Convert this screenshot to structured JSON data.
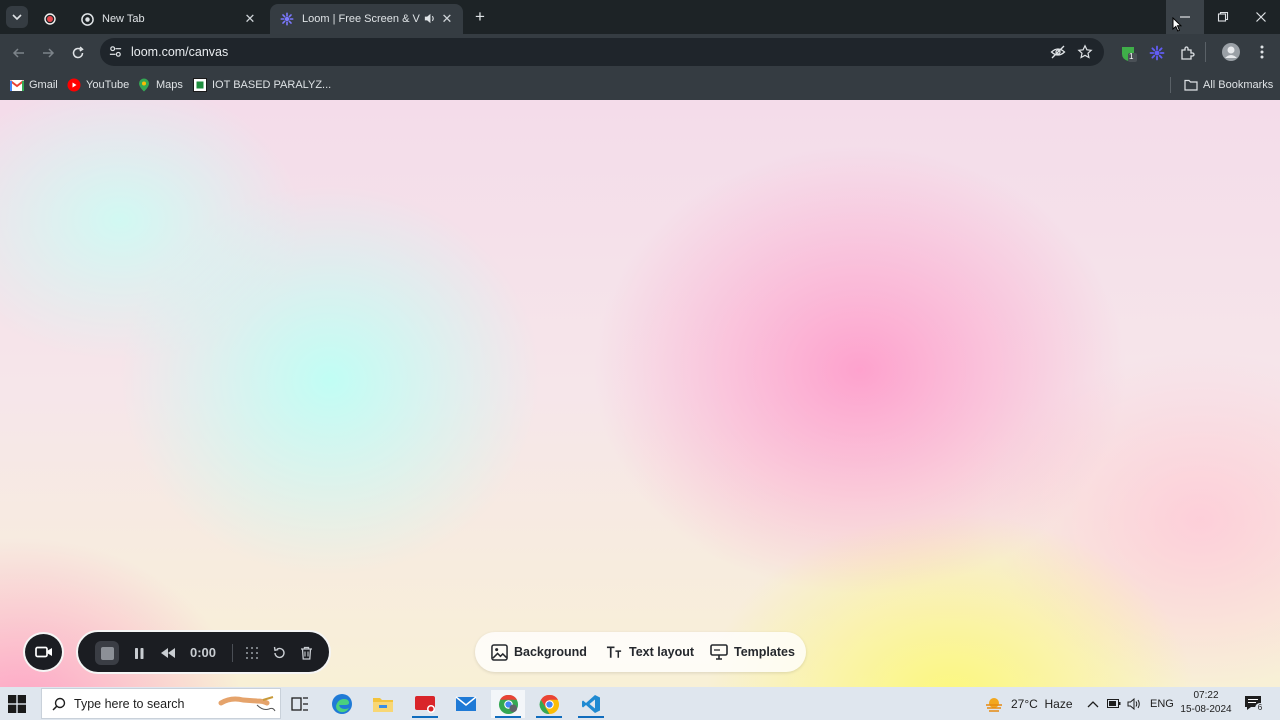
{
  "browser": {
    "tabs": [
      {
        "title": "",
        "favicon": "record-icon",
        "active": false
      },
      {
        "title": "New Tab",
        "favicon": "chrome-icon",
        "active": false
      },
      {
        "title": "Loom | Free Screen & Video",
        "favicon": "loom-icon",
        "active": true,
        "audio": true
      }
    ],
    "url": "loom.com/canvas",
    "extension_badge": "1"
  },
  "bookmarks": {
    "items": [
      {
        "label": "Gmail",
        "icon": "gmail-icon"
      },
      {
        "label": "YouTube",
        "icon": "youtube-icon"
      },
      {
        "label": "Maps",
        "icon": "maps-icon"
      },
      {
        "label": "IOT BASED PARALYZ...",
        "icon": "site-icon"
      }
    ],
    "all_bookmarks": "All Bookmarks"
  },
  "recorder": {
    "time": "0:00"
  },
  "canvas_toolbar": {
    "background": "Background",
    "text_layout": "Text layout",
    "templates": "Templates"
  },
  "taskbar": {
    "search_placeholder": "Type here to search",
    "weather": "27°C  Haze",
    "language": "ENG",
    "time": "07:22",
    "date": "15-08-2024",
    "notification_count": "6"
  },
  "colors": {
    "accent": "#0f6cbd",
    "loom_purple": "#625df5",
    "dark_chrome": "#353c42"
  }
}
